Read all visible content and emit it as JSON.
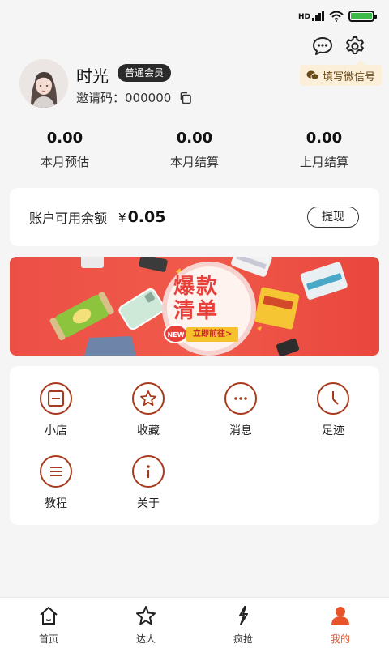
{
  "status_bar": {
    "network_label": "HD"
  },
  "header": {
    "wechat_prompt": "填写微信号"
  },
  "profile": {
    "name": "时光",
    "member_level": "普通会员",
    "invite_label": "邀请码：",
    "invite_code": "000000"
  },
  "stats": [
    {
      "value": "0.00",
      "label": "本月预估"
    },
    {
      "value": "0.00",
      "label": "本月结算"
    },
    {
      "value": "0.00",
      "label": "上月结算"
    }
  ],
  "balance": {
    "label": "账户可用余额",
    "currency": "¥",
    "amount": "0.05",
    "withdraw_label": "提现"
  },
  "banner": {
    "title_line1": "爆款",
    "title_line2": "清单",
    "new_tag": "NEW",
    "cta": "立即前往>"
  },
  "menu": {
    "items": [
      {
        "label": "小店",
        "icon": "shop-icon"
      },
      {
        "label": "收藏",
        "icon": "star-icon"
      },
      {
        "label": "消息",
        "icon": "message-icon"
      },
      {
        "label": "足迹",
        "icon": "clock-icon"
      },
      {
        "label": "教程",
        "icon": "menu-icon"
      },
      {
        "label": "关于",
        "icon": "info-icon"
      }
    ]
  },
  "bottom_nav": {
    "items": [
      {
        "label": "首页",
        "icon": "home-icon"
      },
      {
        "label": "达人",
        "icon": "star-icon"
      },
      {
        "label": "疯抢",
        "icon": "lightning-icon"
      },
      {
        "label": "我的",
        "icon": "user-icon",
        "active": true
      }
    ],
    "active_color": "#e8542a"
  },
  "colors": {
    "accent": "#a73a1e",
    "banner_red": "#ec4f46",
    "badge_dark": "#2a2a2a"
  }
}
